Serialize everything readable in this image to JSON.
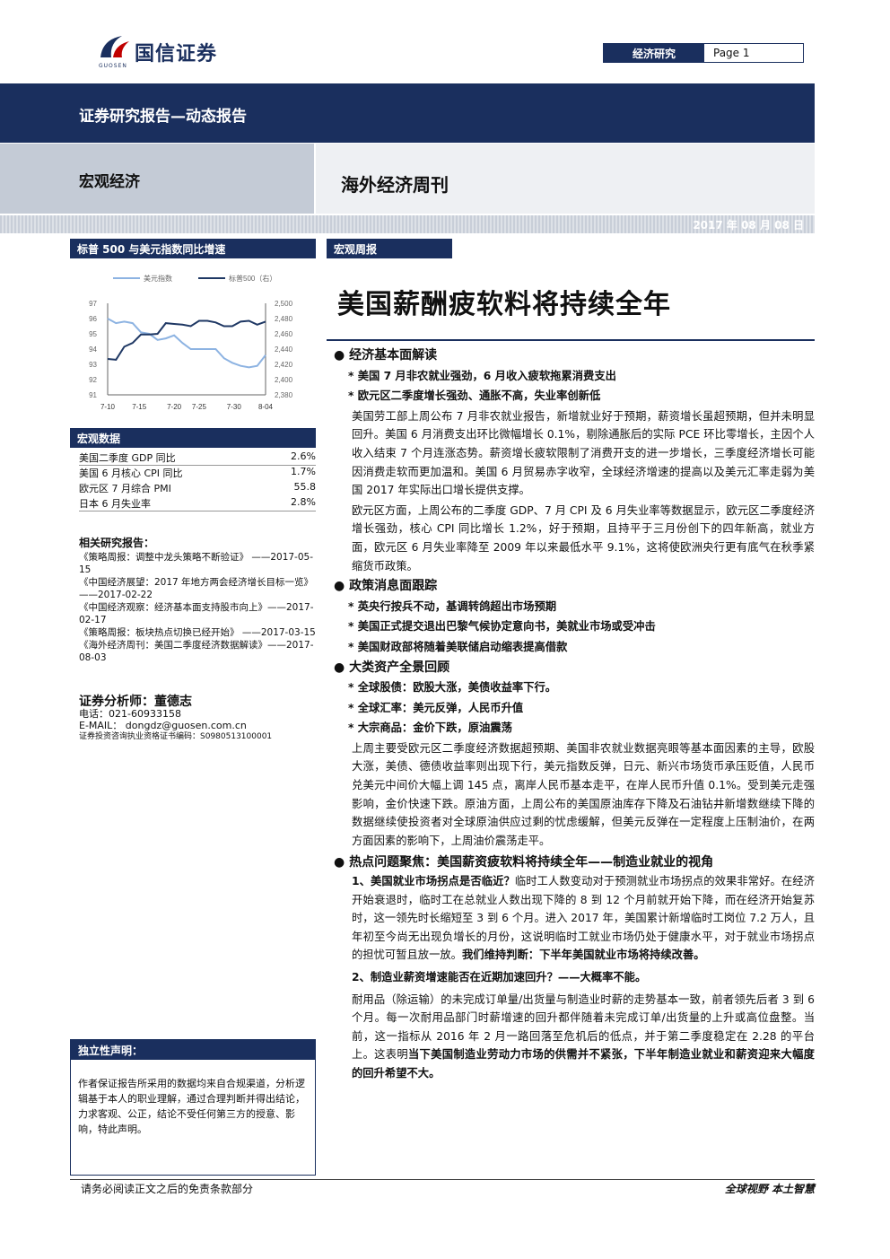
{
  "header": {
    "brand_name": "国信证券",
    "brand_sub": "GUOSEN",
    "section_tag": "经济研究",
    "page_label": "Page 1"
  },
  "banner": {
    "report_type": "证券研究报告—动态报告",
    "category": "宏观经济",
    "series_title": "海外经济周刊",
    "date": "2017 年 08 月 08 日"
  },
  "sidebar": {
    "chart_heading": "标普 500 与美元指数同比增速",
    "macro_heading": "宏观数据",
    "macro_rows": [
      {
        "label": "美国二季度 GDP 同比",
        "value": "2.6%"
      },
      {
        "label": "美国 6 月核心 CPI 同比",
        "value": "1.7%"
      },
      {
        "label": "欧元区 7 月综合 PMI",
        "value": "55.8"
      },
      {
        "label": "日本 6 月失业率",
        "value": "2.8%"
      }
    ],
    "related_heading": "相关研究报告：",
    "related_items": [
      "《策略周报：调整中龙头策略不断验证》 ——2017-05-15",
      "《中国经济展望：2017 年地方两会经济增长目标一览》 ——2017-02-22",
      "《中国经济观察：经济基本面支持股市向上》——2017-02-17",
      "《策略周报：板块热点切换已经开始》 ——2017-03-15",
      "《海外经济周刊：美国二季度经济数据解读》——2017-08-03"
    ],
    "analyst_heading": "证券分析师：董德志",
    "analyst_phone": "电话：021-60933158",
    "analyst_email": "E-MAIL：  dongdz@guosen.com.cn",
    "analyst_cert": "证券投资咨询执业资格证书编码：S0980513100001",
    "independence_heading": "独立性声明：",
    "independence_text": "作者保证报告所采用的数据均来自合规渠道，分析逻辑基于本人的职业理解，通过合理判断并得出结论，力求客观、公正，结论不受任何第三方的授意、影响，特此声明。"
  },
  "chart_data": {
    "type": "line",
    "title": "",
    "x": [
      "7-10",
      "7-11",
      "7-12",
      "7-13",
      "7-14",
      "7-17",
      "7-18",
      "7-19",
      "7-20",
      "7-21",
      "7-24",
      "7-25",
      "7-26",
      "7-27",
      "7-28",
      "7-31",
      "8-01",
      "8-02",
      "8-03",
      "8-04"
    ],
    "xticks": [
      "7-10",
      "7-15",
      "7-20",
      "7-25",
      "7-30",
      "8-04"
    ],
    "series": [
      {
        "name": "美元指数",
        "axis": "left",
        "color": "#8db3e2",
        "values": [
          96.0,
          95.7,
          95.8,
          95.7,
          95.1,
          95.0,
          94.6,
          94.7,
          94.9,
          94.4,
          94.0,
          94.0,
          94.0,
          94.0,
          93.4,
          93.1,
          92.9,
          92.8,
          92.9,
          93.6
        ]
      },
      {
        "name": "标普500（右）",
        "axis": "right",
        "color": "#1f3864",
        "values": [
          2427,
          2426,
          2443,
          2448,
          2459,
          2459,
          2460,
          2474,
          2473,
          2472,
          2470,
          2477,
          2477,
          2475,
          2470,
          2470,
          2476,
          2477,
          2472,
          2476
        ]
      }
    ],
    "ylim_left": [
      91,
      97
    ],
    "yticks_left": [
      "97",
      "96",
      "95",
      "94",
      "93",
      "92",
      "91"
    ],
    "ylim_right": [
      2380,
      2500
    ],
    "yticks_right": [
      "2,500",
      "2,480",
      "2,460",
      "2,440",
      "2,420",
      "2,400",
      "2,380"
    ],
    "legend_position": "top",
    "grid": false
  },
  "main": {
    "report_tag": "宏观周报",
    "title": "美国薪酬疲软料将持续全年",
    "s1_heading": "经济基本面解读",
    "s1_sub1": "美国 7 月非农就业强劲，6 月收入疲软拖累消费支出",
    "s1_sub2": "欧元区二季度增长强劲、通胀不高，失业率创新低",
    "s1_p1": "美国劳工部上周公布 7 月非农就业报告，新增就业好于预期，薪资增长虽超预期，但并未明显回升。美国 6 月消费支出环比微幅增长 0.1%，剔除通胀后的实际 PCE 环比零增长，主因个人收入结束 7 个月连涨态势。薪资增长疲软限制了消费开支的进一步增长，三季度经济增长可能因消费走软而更加温和。美国 6 月贸易赤字收窄，全球经济增速的提高以及美元汇率走弱为美国 2017 年实际出口增长提供支撑。",
    "s1_p2": "欧元区方面，上周公布的二季度 GDP、7 月 CPI 及 6 月失业率等数据显示，欧元区二季度经济增长强劲，核心 CPI 同比增长 1.2%，好于预期，且持平于三月份创下的四年新高，就业方面，欧元区 6 月失业率降至 2009 年以来最低水平 9.1%，这将使欧洲央行更有底气在秋季紧缩货币政策。",
    "s2_heading": "政策消息面跟踪",
    "s2_sub1": "英央行按兵不动，基调转鸽超出市场预期",
    "s2_sub2": "美国正式提交退出巴黎气候协定意向书，美就业市场或受冲击",
    "s2_sub3": "美国财政部将随着美联储启动缩表提高借款",
    "s3_heading": "大类资产全景回顾",
    "s3_sub1": "全球股债：欧股大涨，美债收益率下行。",
    "s3_sub2": "全球汇率：美元反弹，人民币升值",
    "s3_sub3": "大宗商品：金价下跌，原油震荡",
    "s3_p1": "上周主要受欧元区二季度经济数据超预期、美国非农就业数据亮眼等基本面因素的主导，欧股大涨，美债、德债收益率则出现下行，美元指数反弹，日元、新兴市场货币承压贬值，人民币兑美元中间价大幅上调 145 点，离岸人民币基本走平，在岸人民币升值 0.1%。受到美元走强影响，金价快速下跌。原油方面，上周公布的美国原油库存下降及石油钻井新增数继续下降的数据继续使投资者对全球原油供应过剩的忧虑缓解，但美元反弹在一定程度上压制油价，在两方面因素的影响下，上周油价震荡走平。",
    "s4_heading": "热点问题聚焦：美国薪资疲软料将持续全年——制造业就业的视角",
    "s4_q1": "1、美国就业市场拐点是否临近？",
    "s4_p1": "临时工人数变动对于预测就业市场拐点的效果非常好。在经济开始衰退时，临时工在总就业人数出现下降的 8 到 12 个月前就开始下降，而在经济开始复苏时，这一领先时长缩短至 3 到 6 个月。进入 2017 年，美国累计新增临时工岗位 7.2 万人，且年初至今尚无出现负增长的月份，这说明临时工就业市场仍处于健康水平，对于就业市场拐点的担忧可暂且放一放。",
    "s4_p1_bold": "我们维持判断：下半年美国就业市场将持续改善。",
    "s4_q2": "2、制造业薪资增速能否在近期加速回升？——大概率不能。",
    "s4_p2": "耐用品（除运输）的未完成订单量/出货量与制造业时薪的走势基本一致，前者领先后者 3 到 6 个月。每一次耐用品部门时薪增速的回升都伴随着未完成订单/出货量的上升或高位盘整。当前，这一指标从 2016 年 2 月一路回落至危机后的低点，并于第二季度稳定在 2.28 的平台上。这表明",
    "s4_p2_bold": "当下美国制造业劳动力市场的供需并不紧张，下半年制造业就业和薪资迎来大幅度的回升希望不大。"
  },
  "footer": {
    "disclaimer": "请务必阅读正文之后的免责条款部分",
    "slogan": "全球视野  本土智慧"
  }
}
